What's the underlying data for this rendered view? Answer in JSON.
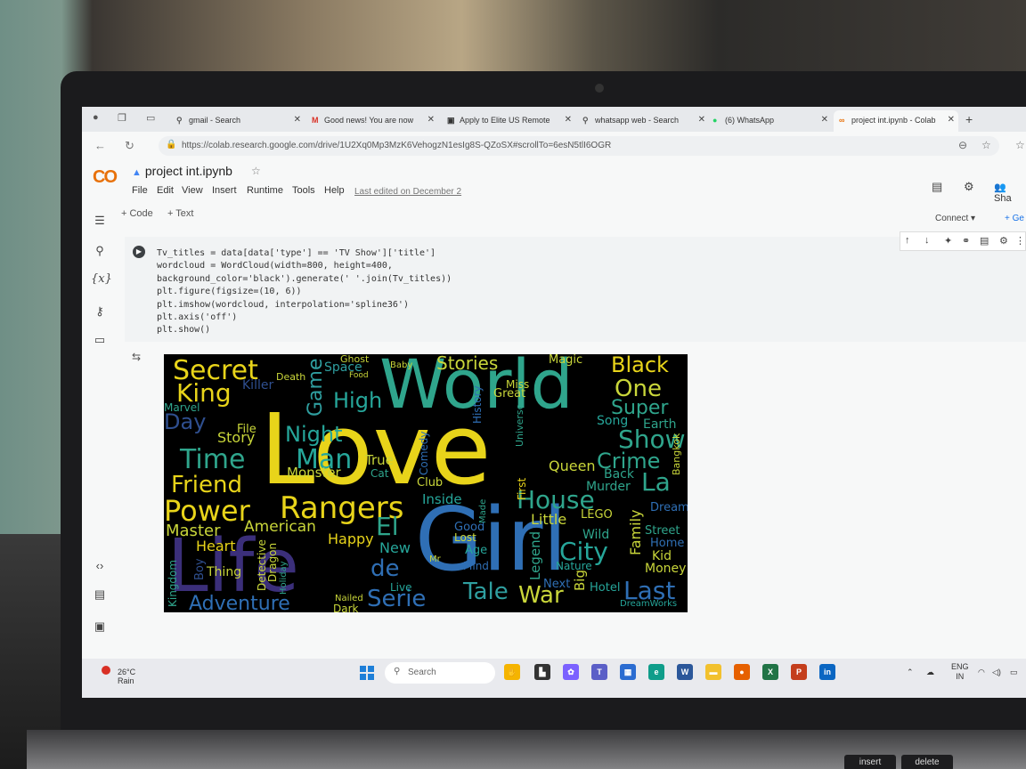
{
  "browser": {
    "tabs": [
      {
        "label": "gmail - Search",
        "favicon": "search-icon"
      },
      {
        "label": "Good news! You are now",
        "favicon": "gmail-icon"
      },
      {
        "label": "Apply to Elite US Remote",
        "favicon": "bookmark-icon"
      },
      {
        "label": "whatsapp web - Search",
        "favicon": "search-icon"
      },
      {
        "label": "(6) WhatsApp",
        "favicon": "whatsapp-icon"
      },
      {
        "label": "project int.ipynb - Colab",
        "favicon": "colab-icon"
      }
    ],
    "url": "https://colab.research.google.com/drive/1U2Xq0Mp3MzK6VehogzN1esIg8S-QZoSX#scrollTo=6esN5tlI6OGR"
  },
  "colab": {
    "logo": "CO",
    "notebook_title": "project int.ipynb",
    "menu": [
      "File",
      "Edit",
      "View",
      "Insert",
      "Runtime",
      "Tools",
      "Help"
    ],
    "last_edited": "Last edited on December 2",
    "share_label": "Sha",
    "add_code": "+ Code",
    "add_text": "+ Text",
    "connect_label": "Connect",
    "gemini_label": "+ Ge",
    "rail_labels": {
      "variables": "{x}"
    }
  },
  "cell": {
    "code_lines": [
      "Tv_titles = data[data['type'] == 'TV Show']['title']",
      "wordcloud = WordCloud(width=800, height=400,",
      "background_color='black').generate(' '.join(Tv_titles))",
      "plt.figure(figsize=(10, 6))",
      "plt.imshow(wordcloud, interpolation='spline36')",
      "plt.axis('off')",
      "plt.show()"
    ]
  },
  "wordcloud": {
    "words": [
      {
        "t": "Love",
        "c": "#e8d41a"
      },
      {
        "t": "Girl",
        "c": "#2f6fb5"
      },
      {
        "t": "World",
        "c": "#2fa58c"
      },
      {
        "t": "Life",
        "c": "#3b2f7a"
      },
      {
        "t": "Rangers",
        "c": "#e8d41a"
      },
      {
        "t": "Power",
        "c": "#e8d41a"
      },
      {
        "t": "Secret",
        "c": "#e8d41a"
      },
      {
        "t": "Black",
        "c": "#e8d41a"
      },
      {
        "t": "Stories",
        "c": "#c9d63a"
      },
      {
        "t": "King",
        "c": "#e8d41a"
      },
      {
        "t": "One",
        "c": "#c9d63a"
      },
      {
        "t": "Super",
        "c": "#2fa58c"
      },
      {
        "t": "High",
        "c": "#26a69a"
      },
      {
        "t": "Show",
        "c": "#2fa58c"
      },
      {
        "t": "Time",
        "c": "#2fa58c"
      },
      {
        "t": "Man",
        "c": "#26a69a"
      },
      {
        "t": "Crime",
        "c": "#2fa58c"
      },
      {
        "t": "Friend",
        "c": "#e8d41a"
      },
      {
        "t": "La",
        "c": "#2fa58c"
      },
      {
        "t": "House",
        "c": "#2fa58c"
      },
      {
        "t": "Night",
        "c": "#26a69a"
      },
      {
        "t": "Game",
        "c": "#2f9fa0"
      },
      {
        "t": "Master",
        "c": "#c9d63a"
      },
      {
        "t": "American",
        "c": "#c9d63a"
      },
      {
        "t": "El",
        "c": "#2fa58c"
      },
      {
        "t": "City",
        "c": "#26a69a"
      },
      {
        "t": "de",
        "c": "#2f6fb5"
      },
      {
        "t": "Tale",
        "c": "#2f9fa0"
      },
      {
        "t": "War",
        "c": "#c9d63a"
      },
      {
        "t": "Last",
        "c": "#2f6fb5"
      },
      {
        "t": "Serie",
        "c": "#2f6fb5"
      },
      {
        "t": "Adventure",
        "c": "#2f6fb5"
      },
      {
        "t": "Day",
        "c": "#2f4f8f"
      },
      {
        "t": "Story",
        "c": "#c9d63a"
      },
      {
        "t": "Monster",
        "c": "#c9d63a"
      },
      {
        "t": "True",
        "c": "#c9d63a"
      },
      {
        "t": "Queen",
        "c": "#c9d63a"
      },
      {
        "t": "Little",
        "c": "#c9d63a"
      },
      {
        "t": "Heart",
        "c": "#e8d41a"
      },
      {
        "t": "Happy",
        "c": "#e8d41a"
      },
      {
        "t": "New",
        "c": "#26a69a"
      },
      {
        "t": "Family",
        "c": "#c9d63a"
      },
      {
        "t": "Kid",
        "c": "#c9d63a"
      },
      {
        "t": "Money",
        "c": "#c9d63a"
      },
      {
        "t": "Club",
        "c": "#c9d63a"
      },
      {
        "t": "Inside",
        "c": "#26a69a"
      },
      {
        "t": "Legend",
        "c": "#2fa58c"
      },
      {
        "t": "Thing",
        "c": "#c9d63a"
      },
      {
        "t": "Murder",
        "c": "#2fa58c"
      },
      {
        "t": "Earth",
        "c": "#2fa58c"
      },
      {
        "t": "Song",
        "c": "#26a69a"
      },
      {
        "t": "Back",
        "c": "#2fa58c"
      },
      {
        "t": "Ghost",
        "c": "#c9d63a"
      },
      {
        "t": "Magic",
        "c": "#c9d63a"
      },
      {
        "t": "Space",
        "c": "#2f9fa0"
      },
      {
        "t": "Killer",
        "c": "#2f4f8f"
      },
      {
        "t": "Marvel",
        "c": "#2fa58c"
      },
      {
        "t": "File",
        "c": "#c9d63a"
      },
      {
        "t": "Wild",
        "c": "#2fa58c"
      },
      {
        "t": "Street",
        "c": "#2fa58c"
      },
      {
        "t": "Home",
        "c": "#2f6fb5"
      },
      {
        "t": "Dream",
        "c": "#2f6fb5"
      },
      {
        "t": "LEGO",
        "c": "#c9d63a"
      },
      {
        "t": "Lost",
        "c": "#c9d63a"
      },
      {
        "t": "Age",
        "c": "#26a69a"
      },
      {
        "t": "Good",
        "c": "#2f6fb5"
      },
      {
        "t": "Nature",
        "c": "#26a69a"
      },
      {
        "t": "Next",
        "c": "#2f6fb5"
      },
      {
        "t": "Big",
        "c": "#c9d63a"
      },
      {
        "t": "Hotel",
        "c": "#26a69a"
      },
      {
        "t": "Live",
        "c": "#26a69a"
      },
      {
        "t": "Dark",
        "c": "#c9d63a"
      },
      {
        "t": "Nailed",
        "c": "#c9d63a"
      },
      {
        "t": "Kingdom",
        "c": "#2fa58c"
      },
      {
        "t": "Boy",
        "c": "#2f4f8f"
      },
      {
        "t": "Detective",
        "c": "#c9d63a"
      },
      {
        "t": "Dragon",
        "c": "#c9d63a"
      },
      {
        "t": "Holiday",
        "c": "#2fa58c"
      },
      {
        "t": "Comedy",
        "c": "#2f6fb5"
      },
      {
        "t": "History",
        "c": "#2f6fb5"
      },
      {
        "t": "Universe",
        "c": "#2fa58c"
      },
      {
        "t": "Bangkok",
        "c": "#c9d63a"
      },
      {
        "t": "Great",
        "c": "#c9d63a"
      },
      {
        "t": "Miss",
        "c": "#c9d63a"
      },
      {
        "t": "Cat",
        "c": "#2fa58c"
      },
      {
        "t": "Mind",
        "c": "#2f6fb5"
      },
      {
        "t": "First",
        "c": "#e8d41a"
      },
      {
        "t": "Death",
        "c": "#c9d63a"
      },
      {
        "t": "Baby",
        "c": "#c9d63a"
      },
      {
        "t": "Food",
        "c": "#c9d63a"
      },
      {
        "t": "Made",
        "c": "#2fa58c"
      },
      {
        "t": "Mr",
        "c": "#c9d63a"
      },
      {
        "t": "DreamWorks",
        "c": "#26a69a"
      }
    ]
  },
  "taskbar": {
    "weather_temp": "26°C",
    "weather_desc": "Rain",
    "search_placeholder": "Search",
    "lang": "ENG",
    "region": "IN"
  },
  "keyboard": {
    "insert": "insert",
    "delete": "delete"
  }
}
